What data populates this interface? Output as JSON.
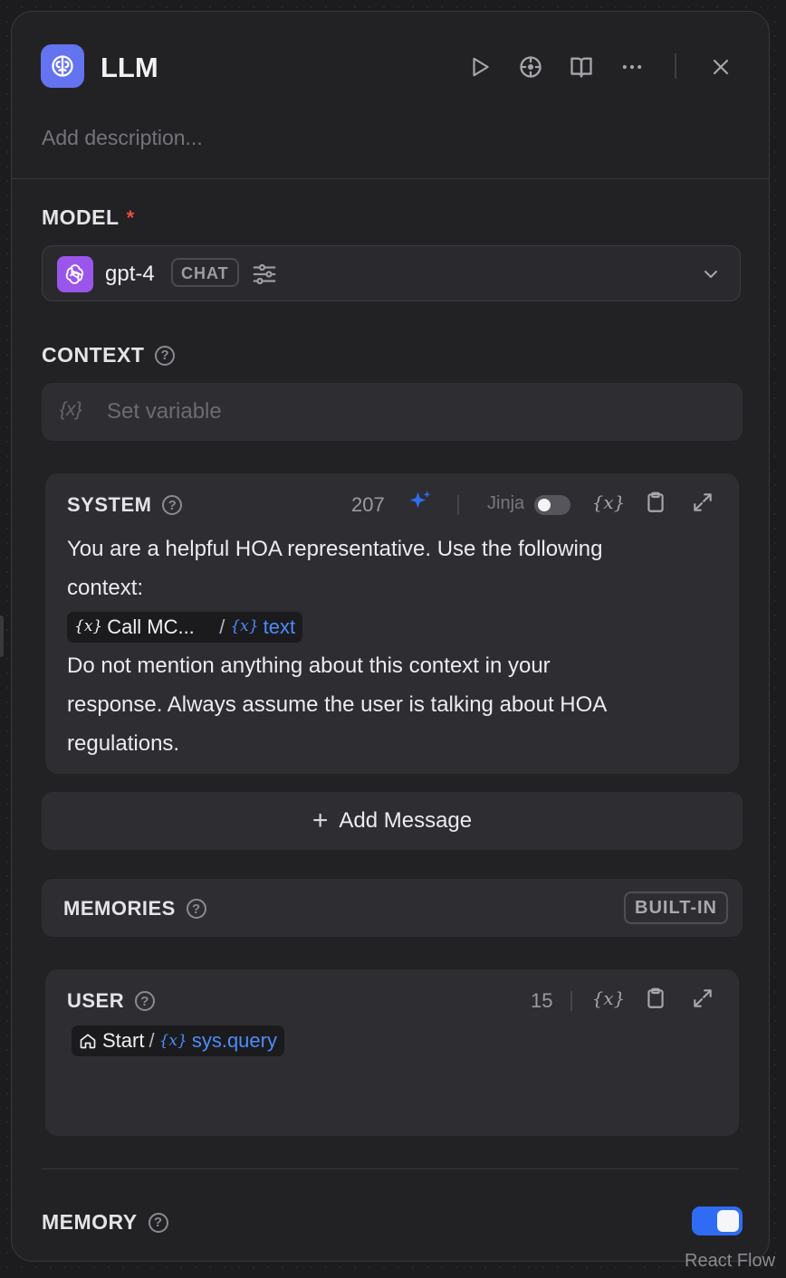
{
  "header": {
    "title": "LLM",
    "description_placeholder": "Add description..."
  },
  "model": {
    "section_label": "MODEL",
    "required_mark": "*",
    "name": "gpt-4",
    "mode_badge": "CHAT"
  },
  "context": {
    "section_label": "CONTEXT",
    "variable_icon": "{x}",
    "placeholder": "Set variable"
  },
  "system": {
    "label": "SYSTEM",
    "char_count": "207",
    "jinja_label": "Jinja",
    "jinja_enabled": false,
    "line1": "You are a helpful HOA representative. Use the following",
    "line2": "context:",
    "chip_node": "Call MC...",
    "chip_separator": "/",
    "chip_var": "text",
    "line3": "Do not mention anything about this context in your",
    "line4": "response. Always assume the user is talking about HOA",
    "line5": "regulations."
  },
  "add_message": {
    "label": "Add Message"
  },
  "memories": {
    "label": "MEMORIES",
    "badge": "BUILT-IN"
  },
  "user": {
    "label": "USER",
    "char_count": "15",
    "chip_node": "Start",
    "chip_separator": "/",
    "chip_var": "sys.query"
  },
  "memory": {
    "section_label": "MEMORY",
    "enabled": true
  },
  "footer": {
    "watermark": "React Flow"
  },
  "colors": {
    "accent_blue": "#2f6cf3",
    "app_icon": "#6473f0",
    "model_logo": "#9a55ea",
    "required": "#f04a3e",
    "variable_blue": "#4e8cf7"
  },
  "icons": {
    "app": "brain-icon",
    "run": "play-icon",
    "locate": "crosshair-icon",
    "docs": "book-open-icon",
    "more": "more-horizontal-icon",
    "close": "close-icon",
    "model_logo": "openai-icon",
    "params": "sliders-icon",
    "dropdown": "chevron-down-icon",
    "generate": "sparkle-icon",
    "clipboard": "clipboard-icon",
    "expand": "expand-icon",
    "home": "home-icon"
  }
}
